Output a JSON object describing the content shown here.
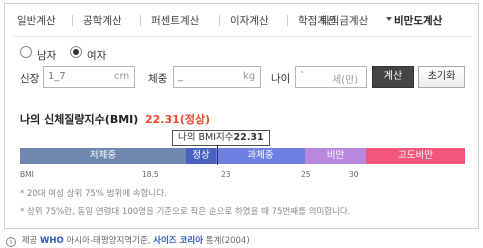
{
  "tabs": [
    {
      "label": "일반계산"
    },
    {
      "label": "공학계산"
    },
    {
      "label": "퍼센트계산"
    },
    {
      "label": "이자계산"
    },
    {
      "label": "학점계산"
    },
    {
      "label": "퇴직금계산"
    },
    {
      "label": "비만도계산"
    }
  ],
  "gender": {
    "male_label": "남자",
    "female_label": "여자",
    "selected": "여자"
  },
  "inputs": {
    "height_label": "신장",
    "height_value": "1_7",
    "height_unit": "cm",
    "weight_label": "체중",
    "weight_value": "_",
    "weight_unit": "kg",
    "age_label": "나이",
    "age_value": "`",
    "age_unit": "세(만)"
  },
  "buttons": {
    "calc": "계산",
    "reset": "초기화"
  },
  "result": {
    "title": "나의 신체질량지수(BMI)",
    "value": "22.31(정상)",
    "marker_prefix": "나의 BMI지수",
    "marker_value": "22.31"
  },
  "scale": {
    "segments": [
      "저체중",
      "정상",
      "과체중",
      "비만",
      "고도비만"
    ],
    "ticks": [
      "BMI",
      "18.5",
      "23",
      "25",
      "30"
    ],
    "colors": [
      "#6f88ad",
      "#4a62bf",
      "#6d7fe2",
      "#b889de",
      "#f0577a"
    ]
  },
  "notes": [
    "* 20대 여성 상위 75% 범위에 속합니다.",
    "* 상위 75%란, 동일 연령대 100명을 기준으로 작은 순으로 하였을 때 75번째를 의미합니다."
  ],
  "source": {
    "prefix": "제공",
    "who": "WHO",
    "middle": "아시아-태평양지역기준,",
    "size_korea": "사이즈 코리아",
    "suffix": "통계(2004)"
  }
}
